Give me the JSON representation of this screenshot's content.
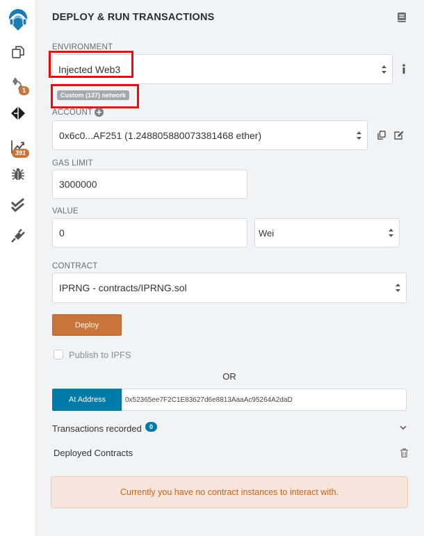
{
  "icons": [
    "remix-logo-icon",
    "file-explorer-icon",
    "solidity-compiler-icon",
    "deploy-run-icon",
    "analysis-icon",
    "debugger-icon",
    "tests-icon",
    "plugin-manager-icon"
  ],
  "sidebar": {
    "compiler_badge": "1",
    "analysis_badge": "391"
  },
  "panel": {
    "title": "DEPLOY & RUN TRANSACTIONS",
    "environment_label": "ENVIRONMENT",
    "environment_value": "Injected Web3",
    "network_badge": "Custom (137) network",
    "account_label": "ACCOUNT",
    "account_value": "0x6c0...AF251 (1.248805880073381468 ether)",
    "gas_limit_label": "GAS LIMIT",
    "gas_limit_value": "3000000",
    "value_label": "VALUE",
    "value_amount": "0",
    "value_unit": "Wei",
    "contract_label": "CONTRACT",
    "contract_value": "IPRNG - contracts/IPRNG.sol",
    "deploy_button": "Deploy",
    "publish_ipfs_label": "Publish to IPFS",
    "or_text": "OR",
    "at_address_button": "At Address",
    "at_address_value": "0x52365ee7F2C1E83627d6e8813AaaAc95264A2daD",
    "transactions_label": "Transactions recorded",
    "transactions_count": "0",
    "deployed_contracts_label": "Deployed Contracts",
    "no_instances_message": "Currently you have no contract instances to interact with."
  },
  "colors": {
    "accent_orange": "#c97539",
    "accent_blue": "#007aa6",
    "highlight_red": "#ee0a0a",
    "alert_bg": "#f7e5dc",
    "alert_text": "#c0651f"
  }
}
